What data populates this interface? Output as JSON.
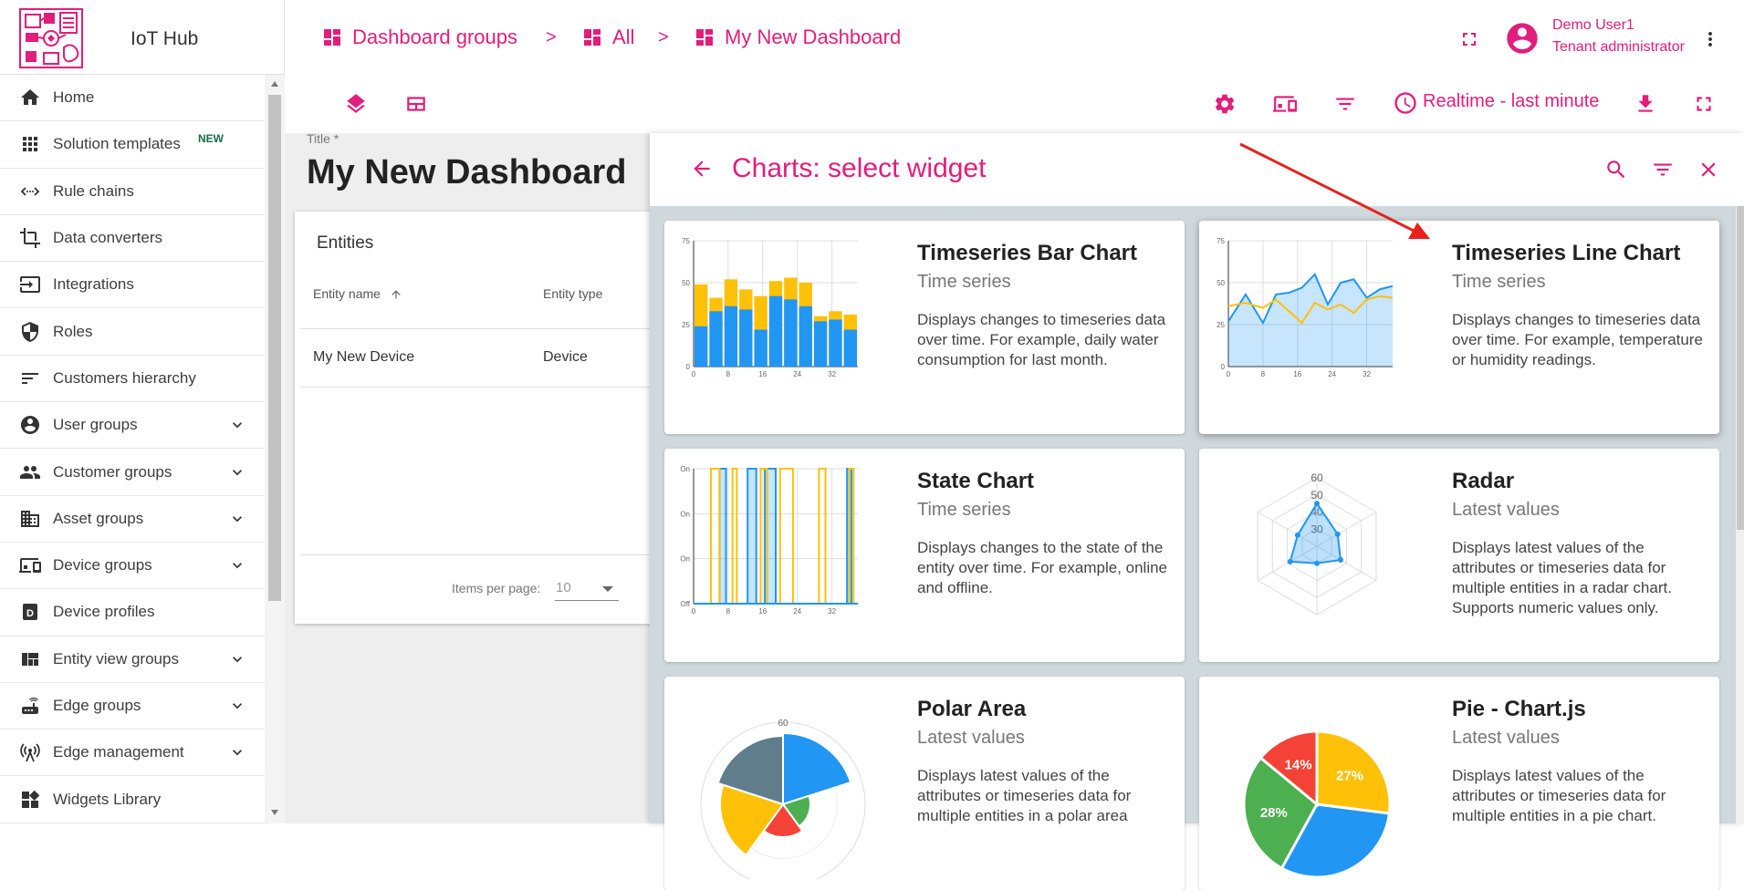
{
  "app": {
    "name": "IoT Hub"
  },
  "colors": {
    "accent": "#e31d7b",
    "blue": "#2196f3",
    "yellow": "#ffc107",
    "green": "#4caf50",
    "red": "#f44336",
    "slate": "#607d8b",
    "arrow": "#e8201c"
  },
  "sidebar": {
    "items": [
      {
        "label": "Home",
        "icon": "home-icon"
      },
      {
        "label": "Solution templates",
        "icon": "apps-grid-icon",
        "badge": "NEW"
      },
      {
        "label": "Rule chains",
        "icon": "code-arrows-icon"
      },
      {
        "label": "Data converters",
        "icon": "crop-icon"
      },
      {
        "label": "Integrations",
        "icon": "input-icon"
      },
      {
        "label": "Roles",
        "icon": "shield-icon"
      },
      {
        "label": "Customers hierarchy",
        "icon": "sort-lines-icon"
      },
      {
        "label": "User groups",
        "icon": "account-circle-icon",
        "expandable": true
      },
      {
        "label": "Customer groups",
        "icon": "people-icon",
        "expandable": true
      },
      {
        "label": "Asset groups",
        "icon": "domain-icon",
        "expandable": true
      },
      {
        "label": "Device groups",
        "icon": "devices-icon",
        "expandable": true
      },
      {
        "label": "Device profiles",
        "icon": "device-profile-icon"
      },
      {
        "label": "Entity view groups",
        "icon": "view-quilt-icon",
        "expandable": true
      },
      {
        "label": "Edge groups",
        "icon": "router-icon",
        "expandable": true
      },
      {
        "label": "Edge management",
        "icon": "antenna-icon",
        "expandable": true
      },
      {
        "label": "Widgets Library",
        "icon": "widgets-icon"
      }
    ]
  },
  "header": {
    "breadcrumbs": [
      "Dashboard groups",
      "All",
      "My New Dashboard"
    ],
    "separator": ">",
    "user_name": "Demo User1",
    "user_role": "Tenant administrator"
  },
  "toolbar": {
    "timewindow": "Realtime - last minute"
  },
  "dashboard": {
    "title_label": "Title *",
    "title": "My New Dashboard",
    "entities_widget": {
      "title": "Entities",
      "columns": [
        "Entity name",
        "Entity type"
      ],
      "rows": [
        [
          "My New Device",
          "Device"
        ]
      ],
      "items_per_page_label": "Items per page:",
      "items_per_page": "10"
    }
  },
  "panel": {
    "title": "Charts: select widget",
    "widgets": [
      {
        "title": "Timeseries Bar Chart",
        "type": "Time series",
        "description": "Displays changes to timeseries data over time. For example, daily water consumption for last month."
      },
      {
        "title": "Timeseries Line Chart",
        "type": "Time series",
        "description": "Displays changes to timeseries data over time. For example, temperature or humidity readings."
      },
      {
        "title": "State Chart",
        "type": "Time series",
        "description": "Displays changes to the state of the entity over time. For example, online and offline."
      },
      {
        "title": "Radar",
        "type": "Latest values",
        "description": "Displays latest values of the attributes or timeseries data for multiple entities in a radar chart. Supports numeric values only."
      },
      {
        "title": "Polar Area",
        "type": "Latest values",
        "description": "Displays latest values of the attributes or timeseries data for multiple entities in a polar area"
      },
      {
        "title": "Pie - Chart.js",
        "type": "Latest values",
        "description": "Displays latest values of the attributes or timeseries data for multiple entities in a pie chart."
      }
    ]
  },
  "chart_data": [
    {
      "type": "bar",
      "name": "timeseries-bar-preview",
      "x_ticks": [
        "0",
        "8",
        "16",
        "24",
        "32"
      ],
      "y_ticks": [
        "0",
        "25",
        "50",
        "75"
      ],
      "ylim": [
        0,
        75
      ],
      "series": [
        {
          "color": "yellow",
          "values": [
            49,
            41,
            52,
            46,
            42,
            51,
            53,
            50,
            30,
            33,
            31
          ]
        },
        {
          "color": "blue",
          "values": [
            24,
            33,
            36,
            34,
            22,
            42,
            40,
            36,
            27,
            28,
            22
          ]
        }
      ]
    },
    {
      "type": "line",
      "name": "timeseries-line-preview",
      "x_ticks": [
        "0",
        "8",
        "16",
        "24",
        "32"
      ],
      "y_ticks": [
        "0",
        "25",
        "50",
        "75"
      ],
      "ylim": [
        0,
        75
      ],
      "xlim": [
        0,
        38
      ],
      "series": [
        {
          "color": "blue",
          "area": true,
          "x": [
            0,
            4,
            8,
            11,
            14,
            17,
            20,
            23,
            26,
            29,
            32,
            35,
            38
          ],
          "values": [
            27,
            43,
            26,
            43,
            44,
            47,
            55,
            37,
            50,
            52,
            41,
            46,
            48
          ]
        },
        {
          "color": "yellow",
          "x": [
            0,
            4,
            8,
            11,
            14,
            17,
            20,
            23,
            26,
            29,
            32,
            35,
            38
          ],
          "values": [
            36,
            38,
            35,
            40,
            33,
            26,
            38,
            34,
            37,
            32,
            40,
            42,
            41
          ]
        }
      ]
    },
    {
      "type": "line",
      "name": "state-chart-preview",
      "x_ticks": [
        "0",
        "8",
        "16",
        "24",
        "32"
      ],
      "y_ticks": [
        "Off",
        "On",
        "On",
        "On"
      ],
      "xlim": [
        0,
        38
      ],
      "series": [
        {
          "color": "blue",
          "area": true,
          "segments": [
            [
              6,
              7.5
            ],
            [
              12.5,
              14.5
            ],
            [
              16.5,
              19
            ],
            [
              35.5,
              36.5
            ]
          ]
        },
        {
          "color": "yellow",
          "segments": [
            [
              4,
              6
            ],
            [
              9,
              10
            ],
            [
              15.5,
              17
            ],
            [
              20,
              23
            ],
            [
              29,
              30.5
            ],
            [
              36,
              37
            ]
          ]
        }
      ]
    },
    {
      "type": "radar",
      "name": "radar-preview",
      "ticks": [
        "30",
        "40",
        "50",
        "60"
      ],
      "series": [
        {
          "color": "blue",
          "values": [
            45,
            34,
            36,
            30,
            38,
            33
          ]
        }
      ]
    },
    {
      "type": "pie",
      "name": "polar-area-preview",
      "ticks": [
        "60"
      ],
      "slices": [
        {
          "color": "blue",
          "value": 52
        },
        {
          "color": "green",
          "value": 20
        },
        {
          "color": "red",
          "value": 24
        },
        {
          "color": "yellow",
          "value": 46
        },
        {
          "color": "slate",
          "value": 50
        }
      ]
    },
    {
      "type": "pie",
      "name": "pie-chartjs-preview",
      "slices": [
        {
          "color": "yellow",
          "value": 27,
          "label": "27%"
        },
        {
          "color": "blue",
          "value": 31,
          "label": ""
        },
        {
          "color": "green",
          "value": 28,
          "label": "28%"
        },
        {
          "color": "red",
          "value": 14,
          "label": "14%"
        }
      ]
    }
  ]
}
